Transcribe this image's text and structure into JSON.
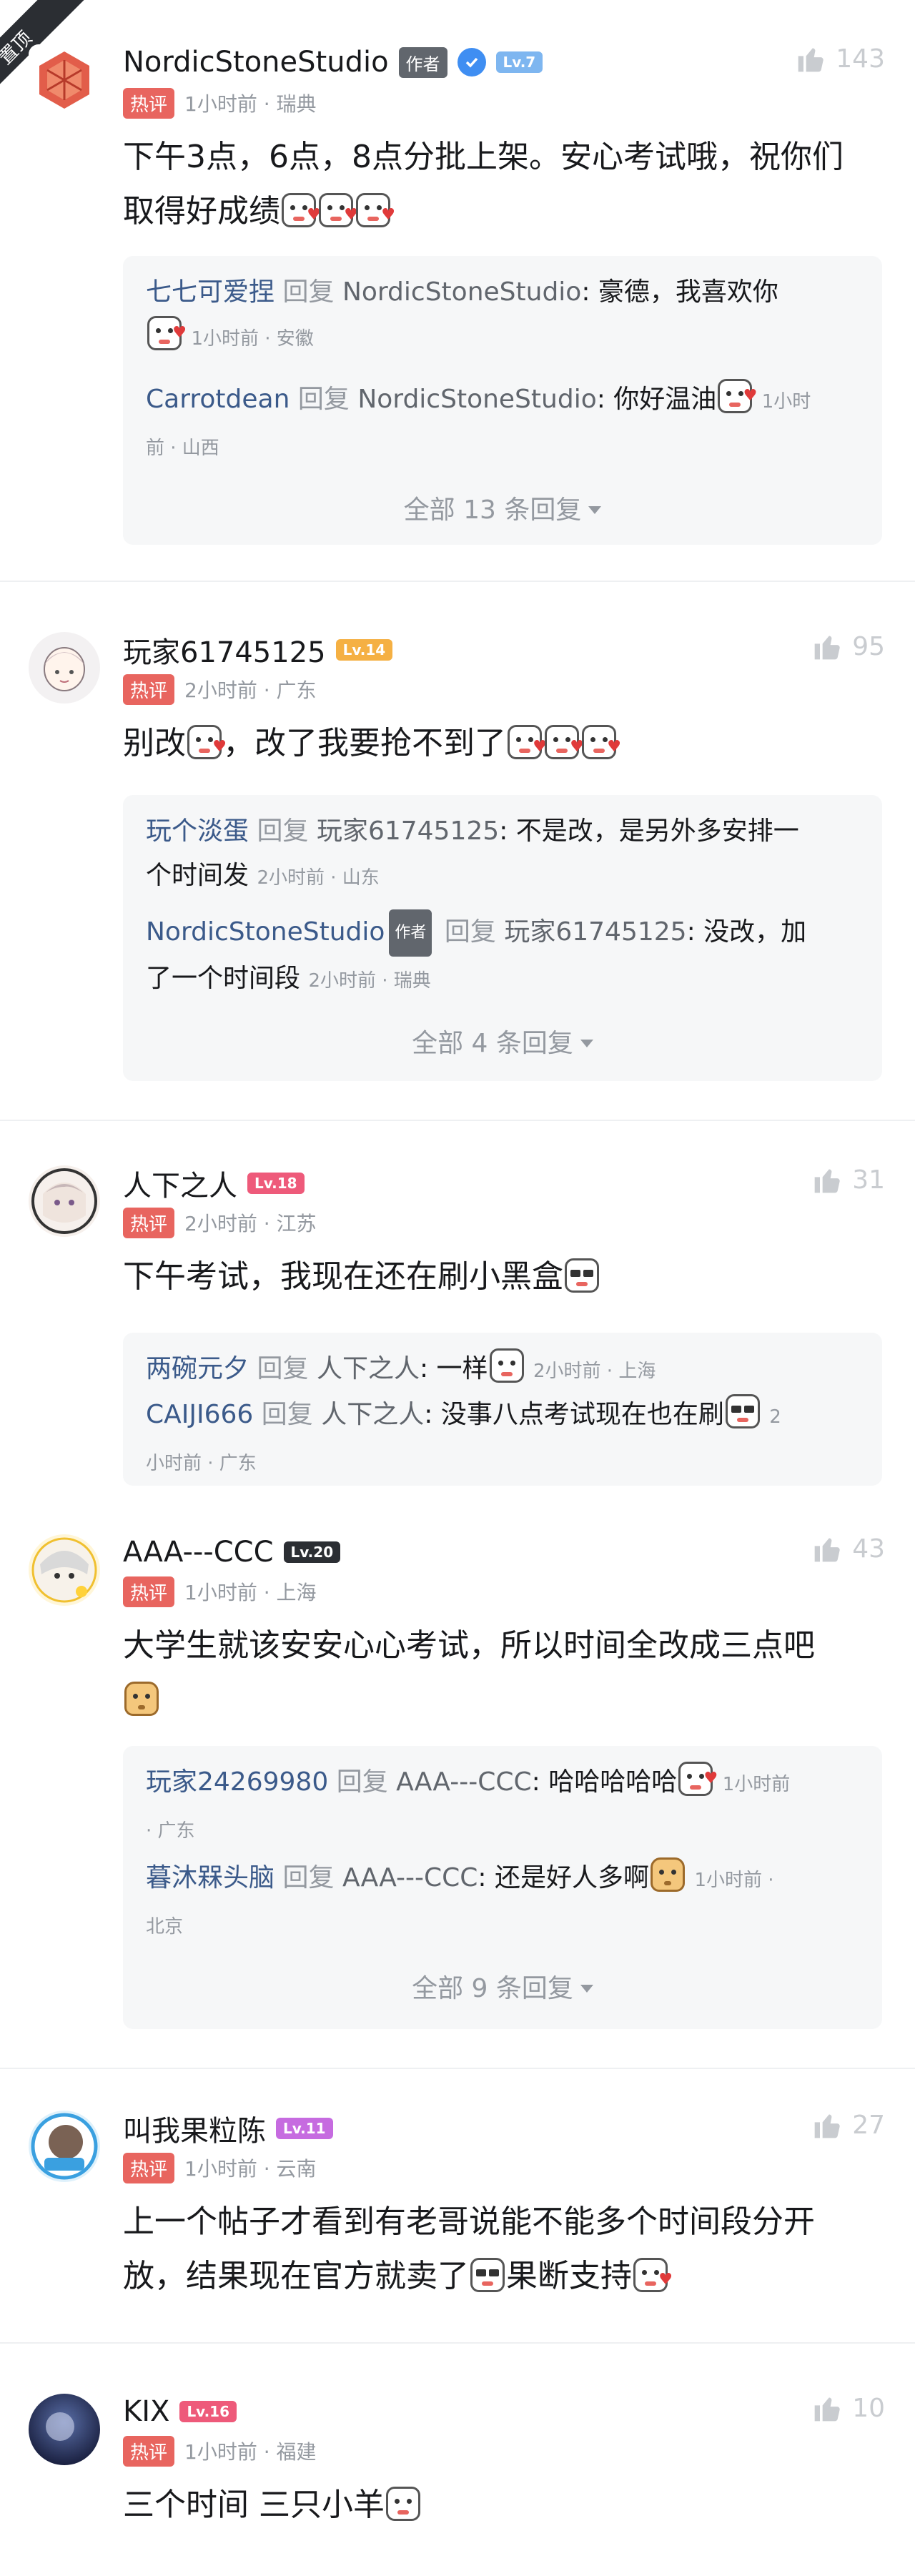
{
  "pinned_label": "置顶",
  "comments": [
    {
      "username": "NordicStoneStudio",
      "author_tag": "作者",
      "level": "Lv.7",
      "level_color": "#7eb6f0",
      "hot": "热评",
      "meta": "1小时前 · 瑞典",
      "likes": "143",
      "text_1": "下午3点，6点，8点分批上架。安心考试哦，祝你们",
      "text_2": "取得好成绩",
      "replies": [
        {
          "user": "七七可爱捏",
          "verb": "回复",
          "at": "NordicStoneStudio",
          "text": ": 豪德，我喜欢你",
          "time": "1小时前 · 安徽"
        },
        {
          "user": "Carrotdean",
          "verb": "回复",
          "at": "NordicStoneStudio",
          "text": ": 你好温油",
          "time": "1小时",
          "time_2": "前 · 山西"
        }
      ],
      "more": "全部 13 条回复"
    },
    {
      "username": "玩家61745125",
      "level": "Lv.14",
      "level_color": "#f5b043",
      "hot": "热评",
      "meta": "2小时前 · 广东",
      "likes": "95",
      "text_1": "别改",
      "text_2": "，改了我要抢不到了",
      "replies": [
        {
          "user": "玩个淡蛋",
          "verb": "回复",
          "at": "玩家61745125",
          "text": ": 不是改，是另外多安排一",
          "text_2": "个时间发",
          "time": "2小时前 · 山东"
        },
        {
          "user": "NordicStoneStudio",
          "author_tag": "作者",
          "verb": "回复",
          "at": "玩家61745125",
          "text": ": 没改，加",
          "text_2": "了一个时间段",
          "time": "2小时前 · 瑞典"
        }
      ],
      "more": "全部 4 条回复"
    },
    {
      "username": "人下之人",
      "level": "Lv.18",
      "level_color": "#ee5a7a",
      "hot": "热评",
      "meta": "2小时前 · 江苏",
      "likes": "31",
      "text_1": "下午考试，我现在还在刷小黑盒",
      "replies": [
        {
          "user": "两碗元夕",
          "verb": "回复",
          "at": "人下之人",
          "text": ": 一样",
          "time": "2小时前 · 上海"
        },
        {
          "user": "CAIJI666",
          "verb": "回复",
          "at": "人下之人",
          "text": ": 没事八点考试现在也在刷",
          "time": "2",
          "time_2": "小时前 · 广东"
        }
      ]
    },
    {
      "username": "AAA---CCC",
      "level": "Lv.20",
      "level_color": "#2b2e33",
      "hot": "热评",
      "meta": "1小时前 · 上海",
      "likes": "43",
      "text_1": "大学生就该安安心心考试，所以时间全改成三点吧",
      "replies": [
        {
          "user": "玩家24269980",
          "verb": "回复",
          "at": "AAA---CCC",
          "text": ": 哈哈哈哈哈",
          "time": "1小时前",
          "time_2": "· 广东"
        },
        {
          "user": "暮沐槑头脑",
          "verb": "回复",
          "at": "AAA---CCC",
          "text": ": 还是好人多啊",
          "time": "1小时前 ·",
          "time_2": "北京"
        }
      ],
      "more": "全部 9 条回复"
    },
    {
      "username": "叫我果粒陈",
      "level": "Lv.11",
      "level_color": "#c66be0",
      "hot": "热评",
      "meta": "1小时前 · 云南",
      "likes": "27",
      "text_1": "上一个帖子才看到有老哥说能不能多个时间段分开",
      "text_2": "放，结果现在官方就卖了",
      "text_3": "果断支持"
    },
    {
      "username": "KIX",
      "level": "Lv.16",
      "level_color": "#ee5a7a",
      "hot": "热评",
      "meta": "1小时前 · 福建",
      "likes": "10",
      "text_1": "三个时间 三只小羊"
    }
  ],
  "icons": {
    "like": "thumbs-up-icon",
    "verified": "verified-check-icon",
    "dropdown": "caret-down-icon"
  }
}
